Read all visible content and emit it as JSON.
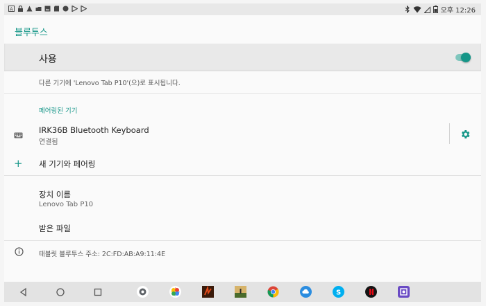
{
  "status_bar": {
    "time": "오후 12:26",
    "left_icons": [
      "notification-a-icon",
      "lock-icon",
      "alert-icon",
      "cloud-icon",
      "image-icon",
      "sd-card-icon",
      "circle-icon",
      "play-icon",
      "play-icon"
    ],
    "right_icons": [
      "bluetooth-icon",
      "wifi-icon",
      "signal-icon",
      "battery-icon"
    ]
  },
  "header": {
    "title": "블루투스"
  },
  "use_toggle": {
    "label": "사용",
    "enabled": true
  },
  "visibility_text": "다른 기기에 'Lenovo Tab P10'(으)로 표시됩니다.",
  "paired_section": {
    "title": "페어링된 기기"
  },
  "paired_devices": [
    {
      "name": "IRK36B Bluetooth Keyboard",
      "status": "연결됨"
    }
  ],
  "pair_new": {
    "label": "새 기기와 페어링"
  },
  "device_name": {
    "label": "장치 이름",
    "value": "Lenovo Tab P10"
  },
  "received_files": {
    "label": "받은 파일"
  },
  "address": {
    "text": "태블릿 블루투스 주소: 2C:FD:AB:A9:11:4E"
  },
  "nav_bar": {
    "buttons": [
      "back-icon",
      "home-icon",
      "recents-icon"
    ],
    "apps": [
      "settings-app",
      "photos-app",
      "game-app",
      "landscape-app",
      "chrome-app",
      "weather-app",
      "skype-app",
      "netflix-app",
      "screen-app"
    ]
  },
  "colors": {
    "accent": "#159688"
  }
}
